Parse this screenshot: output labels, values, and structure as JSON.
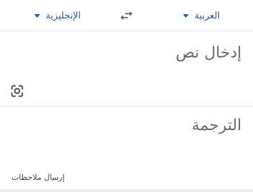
{
  "languages": {
    "target": "الإنجليزية",
    "source": "العربية"
  },
  "input": {
    "placeholder": "إدخال نص"
  },
  "output": {
    "title": "الترجمة"
  },
  "feedback": {
    "label": "إرسال ملاحظات"
  },
  "icons": {
    "swap": "swap-arrows-icon",
    "camera": "camera-lens-icon",
    "dropdown": "caret-down-icon"
  },
  "colors": {
    "accent": "#1a5bc4",
    "text_muted": "#6b6b6b",
    "divider": "#e2e2e2"
  }
}
